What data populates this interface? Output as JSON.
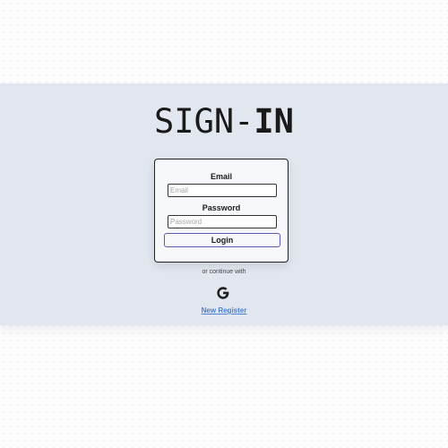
{
  "page": {
    "title_prefix": "SIGN-",
    "title_bold": "IN"
  },
  "form": {
    "email_label": "Email",
    "email_placeholder": "Email",
    "email_value": "",
    "password_label": "Password",
    "password_placeholder": "Password",
    "password_value": "",
    "login_label": "Login"
  },
  "social": {
    "continue_text": "or continue with",
    "provider_icon": "google-icon"
  },
  "footer": {
    "register_link": "New Register"
  },
  "colors": {
    "band": "#e1e6ef",
    "button_border": "#5b5bb3",
    "link": "#4a7fd4"
  }
}
